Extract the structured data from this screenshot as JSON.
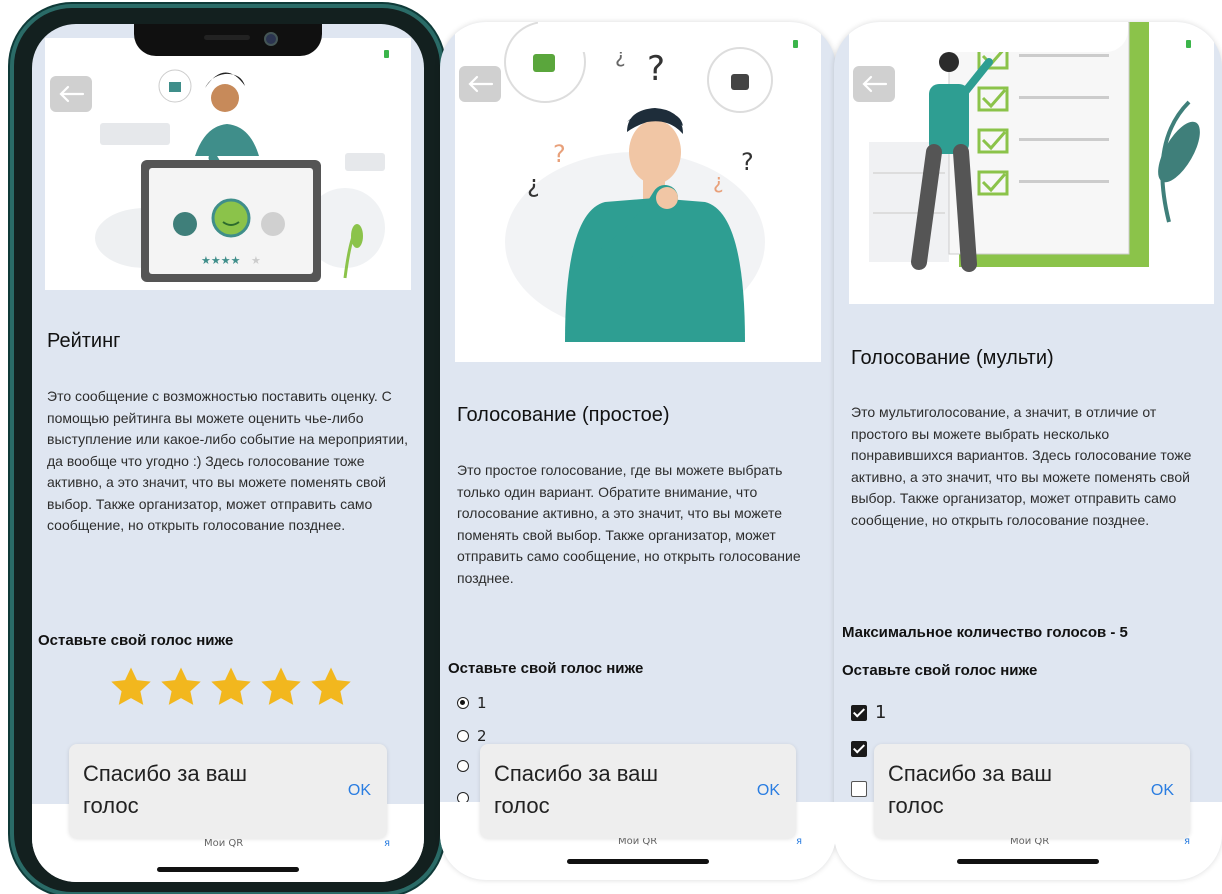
{
  "screens": [
    {
      "title": "Рейтинг",
      "description": "Это сообщение с возможностью поставить оценку. С помощью рейтинга вы можете оценить чье-либо выступление или какое-либо событие на мероприятии, да вообще что угодно :) Здесь голосование тоже активно, а это значит, что вы можете поменять свой выбор. Также организатор, может отправить само сообщение, но открыть голосование позднее.",
      "vote_label": "Оставьте свой голос ниже",
      "rating": 5,
      "rating_max": 5,
      "toast": {
        "message": "Спасибо за ваш голос",
        "ok": "OK"
      },
      "nav": {
        "left": "Мои QR",
        "right": "я"
      }
    },
    {
      "title": "Голосование (простое)",
      "description": "Это простое голосование, где вы можете выбрать только один вариант. Обратите внимание, что голосование активно, а это значит, что вы можете поменять свой выбор. Также организатор, может отправить само сообщение, но открыть голосование позднее.",
      "vote_label": "Оставьте свой голос ниже",
      "options": [
        {
          "label": "1",
          "selected": true
        },
        {
          "label": "2",
          "selected": false
        },
        {
          "label": "",
          "selected": false
        },
        {
          "label": "",
          "selected": false
        }
      ],
      "toast": {
        "message": "Спасибо за ваш голос",
        "ok": "OK"
      },
      "nav": {
        "left": "Мои QR",
        "right": "я"
      }
    },
    {
      "title": "Голосование (мульти)",
      "description": "Это мультиголосование, а значит, в отличие от простого вы можете выбрать несколько понравившихся вариантов. Здесь голосование тоже активно, а это значит, что вы можете поменять свой выбор. Также организатор, может отправить само сообщение, но открыть голосование позднее.",
      "max_votes_label": "Максимальное количество голосов - 5",
      "vote_label": "Оставьте свой голос ниже",
      "options": [
        {
          "label": "1",
          "checked": true
        },
        {
          "label": "",
          "checked": true
        },
        {
          "label": "",
          "checked": false
        }
      ],
      "toast": {
        "message": "Спасибо за ваш голос",
        "ok": "OK"
      },
      "nav": {
        "left": "Мои QR",
        "right": "я"
      }
    }
  ],
  "colors": {
    "background": "#dfe6f1",
    "accent": "#2a7de1",
    "star": "#f2b71e",
    "illustration_teal": "#2e9e92",
    "frame": "#13201f"
  },
  "icons": [
    "back-arrow-icon",
    "thumbs-up-icon",
    "thumbs-down-icon",
    "star-icon",
    "radio-icon",
    "checkbox-icon",
    "camera-icon"
  ]
}
